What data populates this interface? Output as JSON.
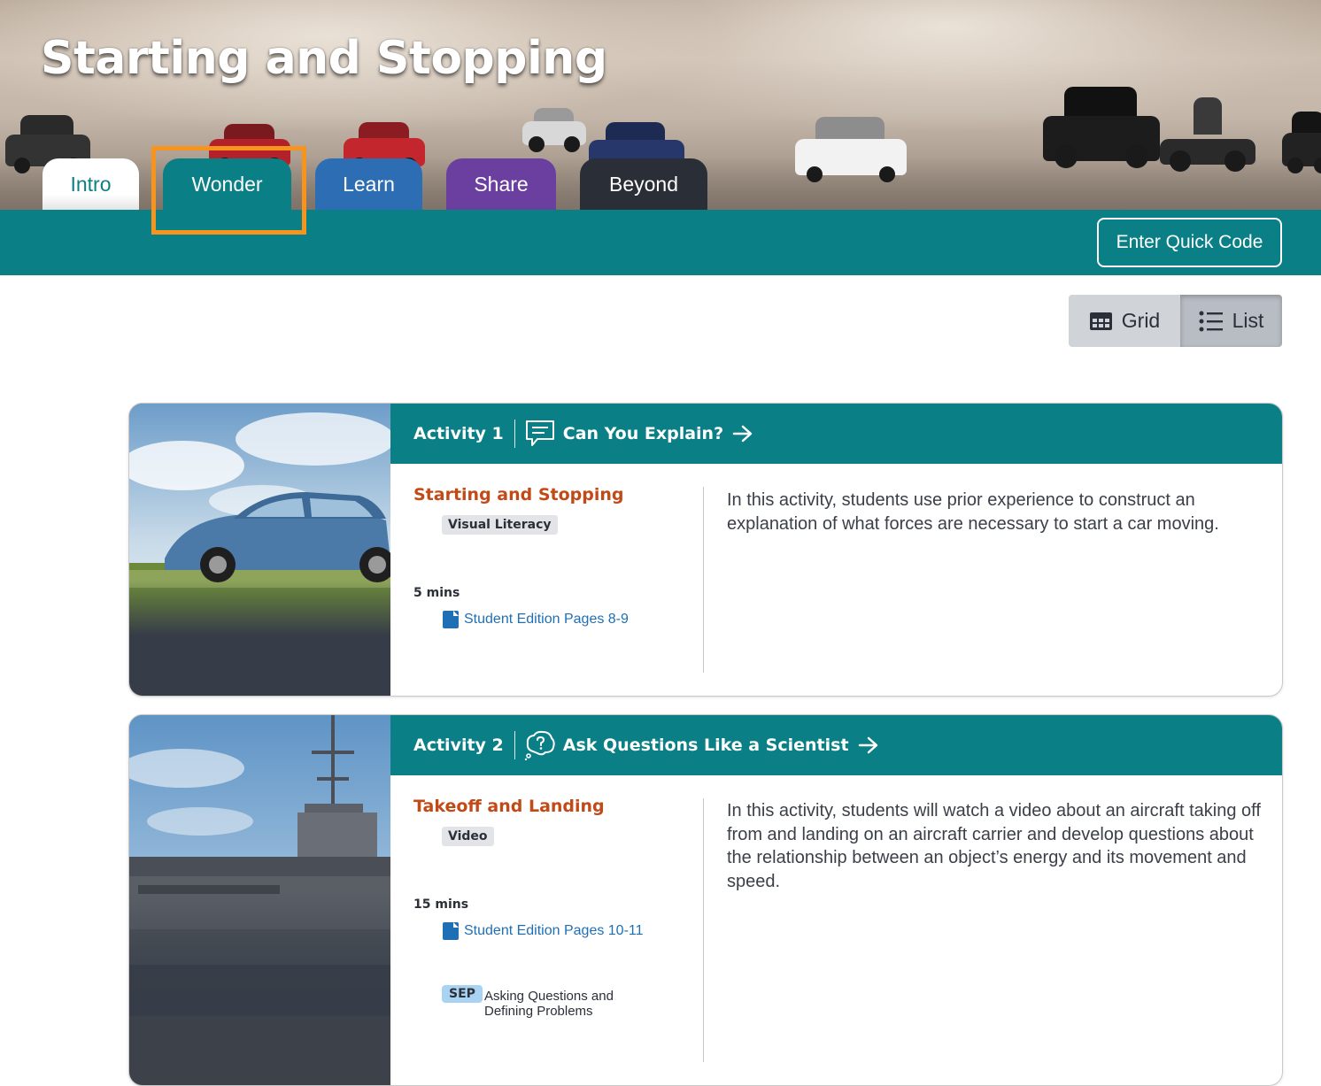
{
  "header": {
    "title": "Starting and Stopping"
  },
  "tabs": [
    {
      "label": "Intro"
    },
    {
      "label": "Wonder"
    },
    {
      "label": "Learn"
    },
    {
      "label": "Share"
    },
    {
      "label": "Beyond"
    }
  ],
  "active_tab": "Wonder",
  "quick_code": {
    "label": "Enter Quick Code"
  },
  "view_toggle": {
    "grid_label": "Grid",
    "list_label": "List",
    "selected": "List"
  },
  "activities": [
    {
      "number_label": "Activity 1",
      "type_icon": "speech-bubble-icon",
      "type_title": "Can You Explain?",
      "lesson_title": "Starting and Stopping",
      "tag": "Visual Literacy",
      "duration": "5 mins",
      "resource_link": "Student Edition Pages 8-9",
      "description": "In this activity, students use prior experience to construct an explanation of what forces are necessary to start a car moving."
    },
    {
      "number_label": "Activity 2",
      "type_icon": "question-thought-icon",
      "type_title": "Ask Questions Like a Scientist",
      "lesson_title": "Takeoff and Landing",
      "tag": "Video",
      "duration": "15 mins",
      "resource_link": "Student Edition Pages 10-11",
      "practice_badge": "SEP",
      "practice_text": "Asking Questions and Defining Problems",
      "description": "In this activity, students will watch a video about an aircraft taking off from and landing on an aircraft carrier and develop questions about the relationship between an object’s energy and its movement and speed."
    }
  ],
  "colors": {
    "teal": "#0a7f85",
    "learn_blue": "#2c6db3",
    "share_purple": "#6b3fa0",
    "beyond_dark": "#2a2e36",
    "highlight_orange": "#f7941d",
    "lesson_title_orange": "#c24a17",
    "link_blue": "#1f6fb5"
  }
}
